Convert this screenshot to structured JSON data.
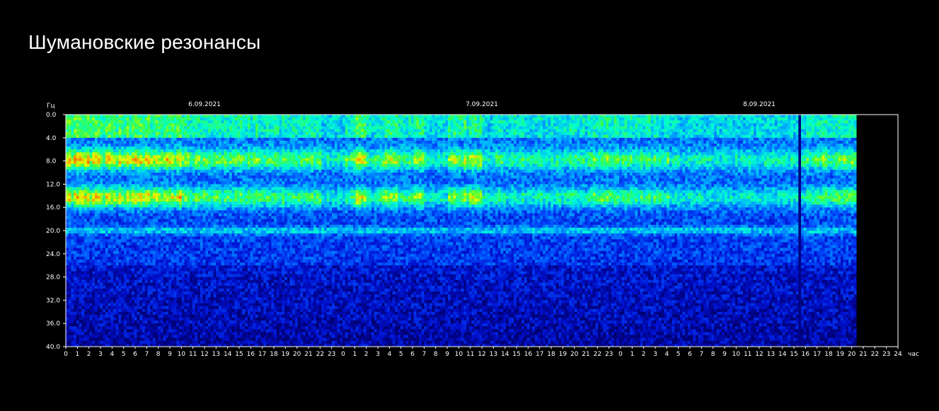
{
  "page": {
    "title": "Шумановские резонансы"
  },
  "chart_data": {
    "type": "heatmap",
    "title": "",
    "ylabel": "Гц",
    "xlabel": "час",
    "ylim": [
      0,
      40
    ],
    "y_inverted": true,
    "y_ticks": [
      "0.0",
      "4.0",
      "8.0",
      "12.0",
      "16.0",
      "20.0",
      "24.0",
      "28.0",
      "32.0",
      "36.0",
      "40.0"
    ],
    "x_ticks": [
      0,
      1,
      2,
      3,
      4,
      5,
      6,
      7,
      8,
      9,
      10,
      11,
      12,
      13,
      14,
      15,
      16,
      17,
      18,
      19,
      20,
      21,
      22,
      23,
      0,
      1,
      2,
      3,
      4,
      5,
      6,
      7,
      8,
      9,
      10,
      11,
      12,
      13,
      14,
      15,
      16,
      17,
      18,
      19,
      20,
      21,
      22,
      23,
      0,
      1,
      2,
      3,
      4,
      5,
      6,
      7,
      8,
      9,
      10,
      11,
      12,
      13,
      14,
      15,
      16,
      17,
      18,
      19,
      20,
      21,
      22,
      23,
      24
    ],
    "x_total_hours": 72,
    "data_end_hour": 68.4,
    "date_labels": [
      {
        "text": "6.09.2021",
        "hour": 12
      },
      {
        "text": "7.09.2021",
        "hour": 36
      },
      {
        "text": "8.09.2021",
        "hour": 60
      }
    ],
    "resonance_bands_hz": [
      7.8,
      14.3,
      20.0
    ],
    "colormap": [
      "#000070",
      "#0010d0",
      "#0050ff",
      "#00b0ff",
      "#00ffd0",
      "#40ff40",
      "#e0ff00",
      "#ff9000",
      "#ff2000",
      "#ffffff"
    ]
  }
}
